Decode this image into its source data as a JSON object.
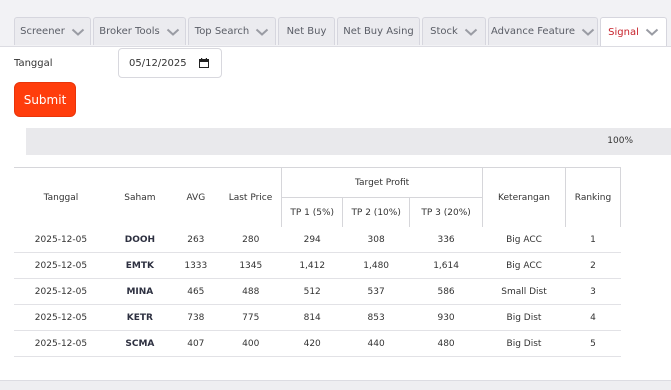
{
  "tabs": [
    {
      "label": "Screener",
      "has_chevron": true
    },
    {
      "label": "Broker Tools",
      "has_chevron": true
    },
    {
      "label": "Top Search",
      "has_chevron": true
    },
    {
      "label": "Net Buy",
      "has_chevron": false
    },
    {
      "label": "Net Buy Asing",
      "has_chevron": false
    },
    {
      "label": "Stock",
      "has_chevron": true
    },
    {
      "label": "Advance Feature",
      "has_chevron": true
    },
    {
      "label": "Signal",
      "has_chevron": true,
      "active": true
    }
  ],
  "form": {
    "date_label": "Tanggal",
    "date_value": "05/12/2025",
    "submit_label": "Submit"
  },
  "progress": {
    "percent": 100,
    "text": "100%"
  },
  "table": {
    "headers": {
      "tanggal": "Tanggal",
      "saham": "Saham",
      "avg": "AVG",
      "last_price": "Last Price",
      "target_profit": "Target Profit",
      "tp1": "TP 1 (5%)",
      "tp2": "TP 2 (10%)",
      "tp3": "TP 3 (20%)",
      "keterangan": "Keterangan",
      "ranking": "Ranking"
    },
    "rows": [
      [
        "2025-12-05",
        "DOOH",
        "263",
        "280",
        "294",
        "308",
        "336",
        "Big ACC",
        "1"
      ],
      [
        "2025-12-05",
        "EMTK",
        "1333",
        "1345",
        "1,412",
        "1,480",
        "1,614",
        "Big ACC",
        "2"
      ],
      [
        "2025-12-05",
        "MINA",
        "465",
        "488",
        "512",
        "537",
        "586",
        "Small Dist",
        "3"
      ],
      [
        "2025-12-05",
        "KETR",
        "738",
        "775",
        "814",
        "853",
        "930",
        "Big Dist",
        "4"
      ],
      [
        "2025-12-05",
        "SCMA",
        "407",
        "400",
        "420",
        "440",
        "480",
        "Big Dist",
        "5"
      ]
    ]
  },
  "colors": {
    "accent": "#ff3d0c",
    "active_tab_text": "#c8232c"
  }
}
